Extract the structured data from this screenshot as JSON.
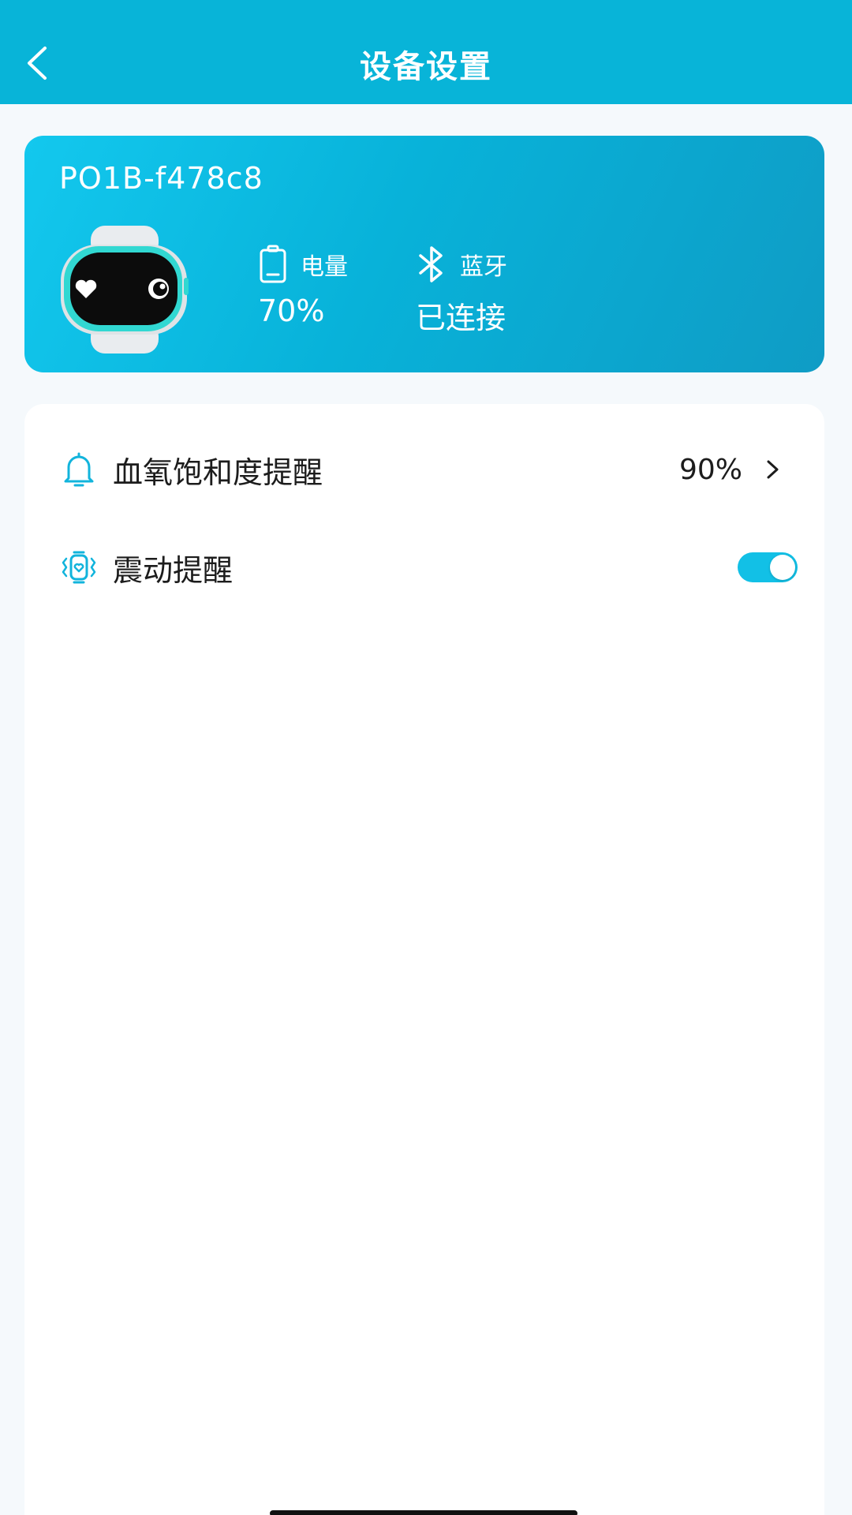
{
  "header": {
    "title": "设备设置"
  },
  "device": {
    "name": "PO1B-f478c8",
    "battery": {
      "label": "电量",
      "value": "70%"
    },
    "bluetooth": {
      "label": "蓝牙",
      "value": "已连接"
    }
  },
  "settings": {
    "spo2_alert": {
      "label": "血氧饱和度提醒",
      "value": "90%"
    },
    "vibration_alert": {
      "label": "震动提醒",
      "enabled": true
    }
  },
  "colors": {
    "header_bg": "#08b4d8",
    "accent": "#12c0e6",
    "card_gradient_start": "#13c8ee",
    "card_gradient_end": "#0f9cc5"
  },
  "icons": {
    "back": "chevron-left-icon",
    "battery": "battery-icon",
    "bluetooth": "bluetooth-icon",
    "spo2": "bell-icon",
    "vibration": "watch-vibrate-icon",
    "arrow": "chevron-right-icon"
  }
}
